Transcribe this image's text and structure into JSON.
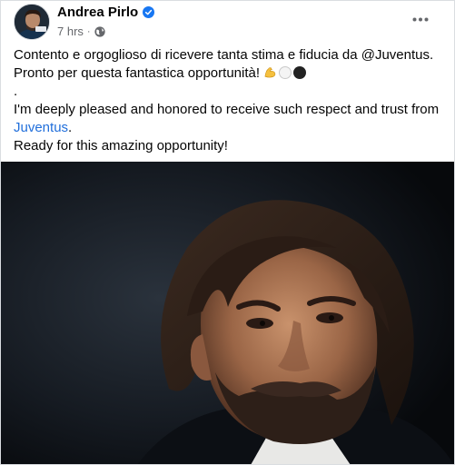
{
  "post": {
    "author": "Andrea Pirlo",
    "time": "7 hrs",
    "separator": "·",
    "lines": {
      "it1": "Contento e orgoglioso di ricevere tanta stima e fiducia da @Juventus.",
      "it2": "Pronto per questa fantastica opportunità!",
      "dot": ".",
      "en1": "I'm deeply pleased and honored to receive such respect and trust from",
      "en_link": "Juventus",
      "en_link_suffix": ".",
      "en3": "Ready for this amazing opportunity!"
    },
    "emojis": [
      "flexed-biceps-icon",
      "white-circle-icon",
      "black-circle-icon"
    ],
    "colors": {
      "link": "#216fdb",
      "verified": "#1877f2",
      "meta": "#65676b"
    }
  }
}
